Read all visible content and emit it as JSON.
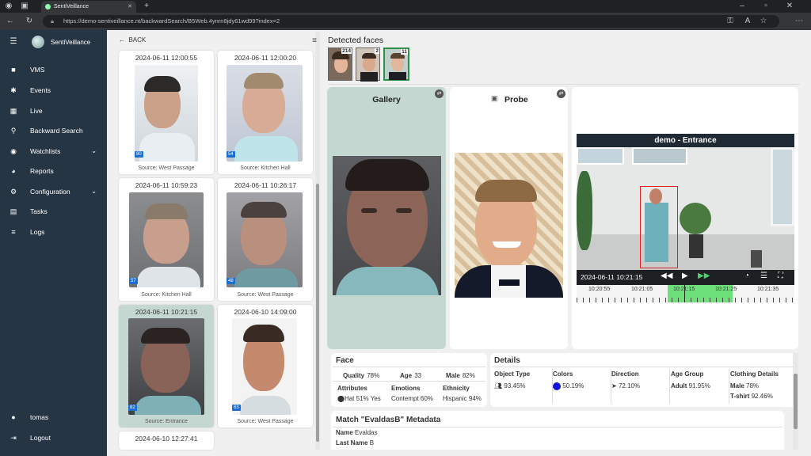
{
  "browser": {
    "tab_title": "SentiVeillance",
    "url": "https://demo-sentiveillance.nt/backwardSearch/B5Web.4ynrn8jdy61wd99?index=2"
  },
  "brand": "SentiVeillance",
  "menu": [
    {
      "label": "VMS",
      "icon": "camera-icon"
    },
    {
      "label": "Events",
      "icon": "gear-icon"
    },
    {
      "label": "Live",
      "icon": "grid-icon"
    },
    {
      "label": "Backward Search",
      "icon": "search-icon"
    },
    {
      "label": "Watchlists",
      "icon": "eye-icon"
    },
    {
      "label": "Reports",
      "icon": "pie-icon"
    },
    {
      "label": "Configuration",
      "icon": "gear-icon"
    },
    {
      "label": "Tasks",
      "icon": "clipboard-icon"
    },
    {
      "label": "Logs",
      "icon": "list-icon"
    }
  ],
  "user": {
    "name": "tomas",
    "logout": "Logout"
  },
  "back_label": "BACK",
  "detected_faces_title": "Detected faces",
  "detected_faces": [
    {
      "count": "214"
    },
    {
      "count": "2"
    },
    {
      "count": "11"
    }
  ],
  "results": [
    {
      "time": "2024-06-11 12:00:55",
      "score": "80",
      "source": "Source: West Passage"
    },
    {
      "time": "2024-06-11 12:00:20",
      "score": "54",
      "source": "Source: Kitchen Hall"
    },
    {
      "time": "2024-06-11 10:59:23",
      "score": "57",
      "source": "Source: Kitchen Hall"
    },
    {
      "time": "2024-06-11 10:26:17",
      "score": "48",
      "source": "Source: West Passage"
    },
    {
      "time": "2024-06-11 10:21:15",
      "score": "82",
      "source": "Source: Entrance"
    },
    {
      "time": "2024-06-10 14:09:00",
      "score": "63",
      "source": "Source: West Passage"
    },
    {
      "time": "2024-06-10 12:27:41"
    }
  ],
  "gallery_title": "Gallery",
  "probe_title": "Probe",
  "video": {
    "title": "demo - Entrance",
    "time": "2024-06-11 10:21:15",
    "timeline": [
      "10:20:55",
      "10:21:05",
      "10:21:15",
      "10:21:25",
      "10:21:35"
    ]
  },
  "face": {
    "title": "Face",
    "quality_label": "Quality",
    "quality": "78%",
    "age_label": "Age",
    "age": "33",
    "gender_label": "Male",
    "gender": "82%",
    "attributes_label": "Attributes",
    "attributes": "Hat 51% Yes",
    "emotions_label": "Emotions",
    "emotions": "Contempt 60%",
    "ethnicity_label": "Ethnicity",
    "ethnicity": "Hispanic 94%"
  },
  "details": {
    "title": "Details",
    "object_type_label": "Object Type",
    "object_type": "93.45%",
    "colors_label": "Colors",
    "colors": "50.19%",
    "direction_label": "Direction",
    "direction": "72.10%",
    "age_group_label": "Age Group",
    "age_group": "Adult",
    "age_group_pct": "91.95%",
    "clothing_label": "Clothing Details",
    "cloth1": "Male",
    "cloth1_pct": "78%",
    "cloth2": "T-shirt",
    "cloth2_pct": "92.46%"
  },
  "match": {
    "title": "Match \"EvaldasB\" Metadata",
    "name_label": "Name",
    "name": "Evaldas",
    "last_label": "Last Name",
    "last": "B"
  }
}
